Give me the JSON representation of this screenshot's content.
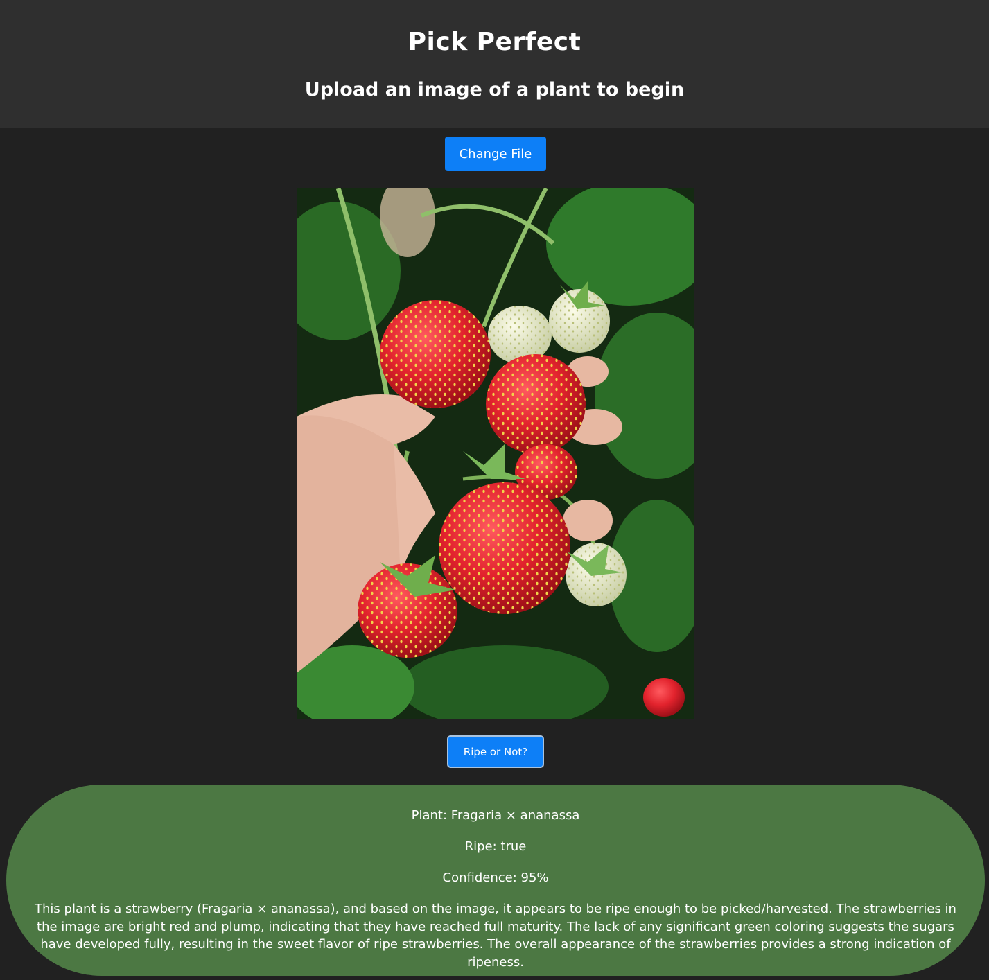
{
  "header": {
    "title": "Pick Perfect",
    "subtitle": "Upload an image of a plant to begin"
  },
  "upload": {
    "change_file_label": "Change File"
  },
  "photo": {
    "subject": "strawberries-in-hand"
  },
  "action": {
    "ripe_button_label": "Ripe or Not?"
  },
  "result": {
    "plant": "Plant: Fragaria × ananassa",
    "ripe": "Ripe: true",
    "confidence": "Confidence: 95%",
    "description": "This plant is a strawberry (Fragaria × ananassa), and based on the image, it appears to be ripe enough to be picked/harvested. The strawberries in the image are bright red and plump, indicating that they have reached full maturity. The lack of any significant green coloring suggests the sugars have developed fully, resulting in the sweet flavor of ripe strawberries. The overall appearance of the strawberries provides a strong indication of ripeness."
  },
  "colors": {
    "header_bg": "#2f2f2f",
    "page_bg": "#212121",
    "button_blue": "#0d7ff7",
    "result_green": "#4c7843"
  }
}
